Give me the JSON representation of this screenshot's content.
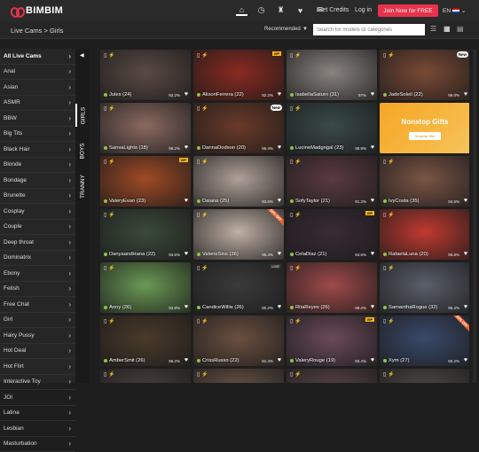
{
  "brand": {
    "name": "BIMBIM",
    "accent": "#e6324b"
  },
  "header": {
    "credits": "Get Credits",
    "login": "Log in",
    "join": "Join Now for FREE",
    "lang": "EN"
  },
  "nav_icons": [
    "home-icon",
    "clock-icon",
    "trophy-icon",
    "heart-icon",
    "chat-icon"
  ],
  "breadcrumb": "Live Cams > Girls",
  "sort": {
    "selected": "Recommended"
  },
  "search": {
    "placeholder": "Search for models or categories"
  },
  "tabs": [
    "GIRLS",
    "BOYS",
    "TRANNY"
  ],
  "categories": [
    {
      "label": "All Live Cams"
    },
    {
      "label": "Anal"
    },
    {
      "label": "Asian"
    },
    {
      "label": "ASMR"
    },
    {
      "label": "BBW"
    },
    {
      "label": "Big Tits"
    },
    {
      "label": "Black Hair"
    },
    {
      "label": "Blonde"
    },
    {
      "label": "Bondage"
    },
    {
      "label": "Brunette"
    },
    {
      "label": "Cosplay"
    },
    {
      "label": "Couple"
    },
    {
      "label": "Deep throat"
    },
    {
      "label": "Dominatrix"
    },
    {
      "label": "Ebony"
    },
    {
      "label": "Fetish"
    },
    {
      "label": "Free Chat"
    },
    {
      "label": "Girl"
    },
    {
      "label": "Hairy Pussy"
    },
    {
      "label": "Hot Deal",
      "badge": "NEW"
    },
    {
      "label": "Hot Flirt"
    },
    {
      "label": "Interactive Toy"
    },
    {
      "label": "JOI"
    },
    {
      "label": "Latina"
    },
    {
      "label": "Lesbian"
    },
    {
      "label": "Masturbation"
    }
  ],
  "promo": {
    "title": "Nonstop Gifts",
    "button": "Surprise Me!"
  },
  "cards": [
    {
      "name": "Jules (24)",
      "pct": "92.2%",
      "bg": "#5a4a44"
    },
    {
      "name": "AlisonFerrera (22)",
      "pct": "92.2%",
      "bg": "#8a2a20",
      "vip": "VIP"
    },
    {
      "name": "IsabellaSaturn (31)",
      "pct": "97%",
      "bg": "#8a8480"
    },
    {
      "name": "JadeSoleil (22)",
      "pct": "98.0%",
      "bg": "#7a4a35",
      "new": "New"
    },
    {
      "name": "SansaLights (18)",
      "pct": "96.2%",
      "bg": "#8a6a60"
    },
    {
      "name": "DannaDodson (20)",
      "pct": "96.4%",
      "bg": "#6a3a28",
      "new": "New"
    },
    {
      "name": "LucineMadgrigal (23)",
      "pct": "98.9%",
      "bg": "#3a4a4a"
    },
    {
      "name": "",
      "promo": true
    },
    {
      "name": "ValeryEvan (23)",
      "pct": "",
      "bg": "#a04a25",
      "vip": "VIP"
    },
    {
      "name": "Daiana (25)",
      "pct": "93.6%",
      "bg": "#b0a098"
    },
    {
      "name": "SofyTaylor (21)",
      "pct": "91.2%",
      "bg": "#5a3a40"
    },
    {
      "name": "IvyCosta (35)",
      "pct": "94.6%",
      "bg": "#7a5545"
    },
    {
      "name": "DanyaandHana (22)",
      "pct": "93.6%",
      "bg": "#3a4a3a"
    },
    {
      "name": "ValerieSins (36)",
      "pct": "95.4%",
      "bg": "#c0b0a5",
      "corner": "50% OFF"
    },
    {
      "name": "CelaDiaz (21)",
      "pct": "94.6%",
      "bg": "#3a2a35",
      "vip": "VIP"
    },
    {
      "name": "RafaelaLuna (20)",
      "pct": "95.8%",
      "bg": "#c03a30"
    },
    {
      "name": "Anny (26)",
      "pct": "93.8%",
      "bg": "#6a9a55"
    },
    {
      "name": "CandiceWillis (26)",
      "pct": "90.2%",
      "bg": "#3a3a3a",
      "live": "LIVE"
    },
    {
      "name": "RitaReyes (26)",
      "pct": "89.2%",
      "bg": "#a04a4a"
    },
    {
      "name": "SamanthaRogue (32)",
      "pct": "95.4%",
      "bg": "#5a5f6a"
    },
    {
      "name": "AmberSmit (26)",
      "pct": "96.2%",
      "bg": "#4a3a2a"
    },
    {
      "name": "CrissRusso (22)",
      "pct": "91.4%",
      "bg": "#6a5040"
    },
    {
      "name": "ValeryRouge (19)",
      "pct": "93.4%",
      "bg": "#6a4a5a",
      "vip": "VIP"
    },
    {
      "name": "Xym (27)",
      "pct": "90.2%",
      "bg": "#3a4a6a",
      "corner": "50% OFF"
    },
    {
      "name": "",
      "pct": "",
      "bg": "#4a4040"
    },
    {
      "name": "",
      "pct": "",
      "bg": "#6a5548"
    },
    {
      "name": "",
      "pct": "",
      "bg": "#5a4545"
    },
    {
      "name": "",
      "pct": "",
      "bg": "#504a48"
    }
  ]
}
